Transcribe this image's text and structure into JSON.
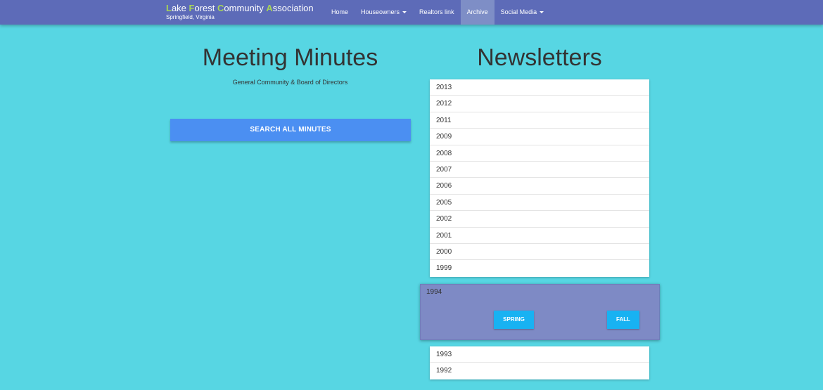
{
  "brand": {
    "title_parts": [
      {
        "text": "L",
        "highlight": true
      },
      {
        "text": "ake ",
        "highlight": false
      },
      {
        "text": "F",
        "highlight": true
      },
      {
        "text": "orest ",
        "highlight": false
      },
      {
        "text": "C",
        "highlight": true
      },
      {
        "text": "ommunity ",
        "highlight": false
      },
      {
        "text": "A",
        "highlight": true
      },
      {
        "text": "ssociation",
        "highlight": false
      }
    ],
    "subtitle": "Springfield, Virginia",
    "highlight_color": "#a6d457"
  },
  "nav": {
    "items": [
      {
        "label": "Home",
        "dropdown": false,
        "active": false
      },
      {
        "label": "Houseowners",
        "dropdown": true,
        "active": false
      },
      {
        "label": "Realtors link",
        "dropdown": false,
        "active": false
      },
      {
        "label": "Archive",
        "dropdown": false,
        "active": true
      },
      {
        "label": "Social Media",
        "dropdown": true,
        "active": false
      }
    ]
  },
  "minutes": {
    "title": "Meeting Minutes",
    "subtitle": "General Community & Board of Directors",
    "search_label": "SEARCH ALL MINUTES"
  },
  "newsletters": {
    "title": "Newsletters",
    "years_upper": [
      "2013",
      "2012",
      "2011",
      "2009",
      "2008",
      "2007",
      "2006",
      "2005",
      "2002",
      "2001",
      "2000",
      "1999"
    ],
    "expanded": {
      "year": "1994",
      "spring_label": "SPRING",
      "fall_label": "FALL"
    },
    "years_lower": [
      "1993",
      "1992"
    ]
  },
  "colors": {
    "background": "#57d6e3",
    "navbar": "#5d6bb8",
    "search_button": "#4b8ff2",
    "expanded_panel": "#7e8ac5",
    "season_button": "#18b2f2"
  }
}
